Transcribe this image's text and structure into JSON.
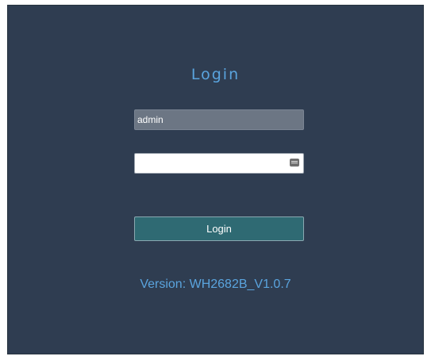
{
  "login": {
    "title": "Login",
    "username_value": "admin",
    "password_value": "",
    "button_label": "Login",
    "version_text": "Version: WH2682B_V1.0.7"
  },
  "colors": {
    "panel_background": "#2f3d51",
    "accent_text": "#5aa4de",
    "button_background": "#2f6a73"
  },
  "icons": {
    "password_field": "keyboard-icon"
  }
}
